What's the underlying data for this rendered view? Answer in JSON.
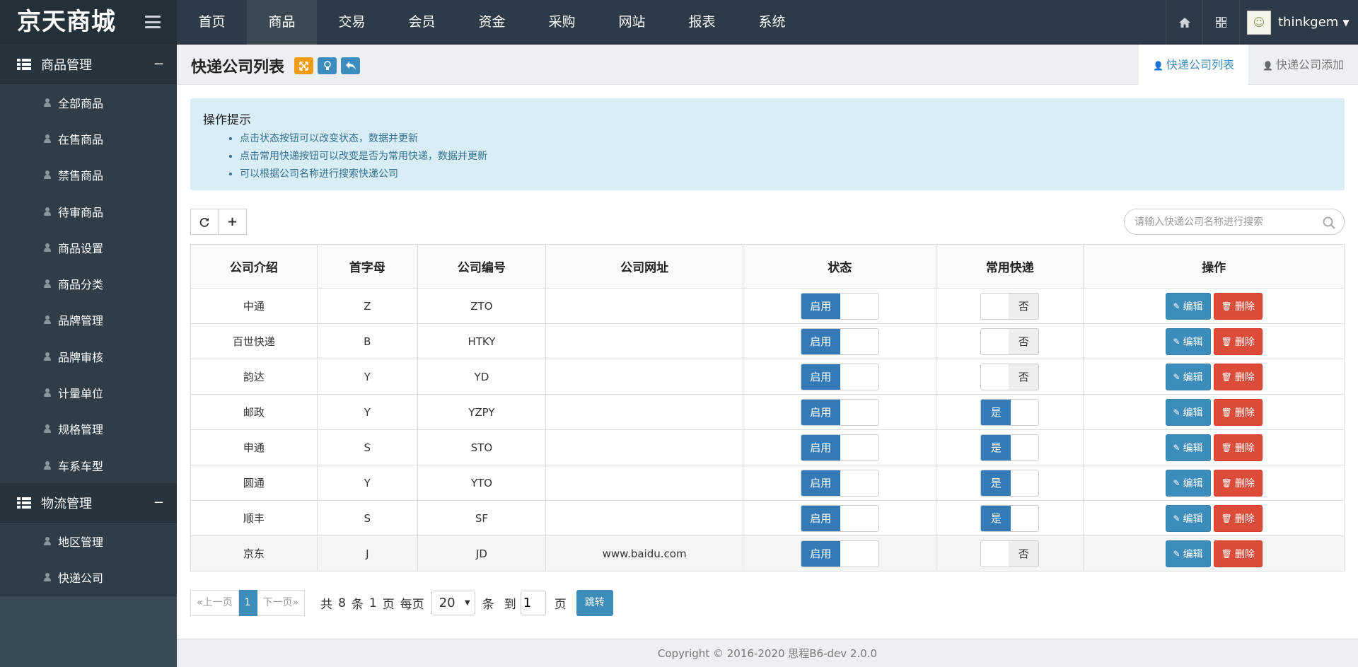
{
  "brand": "京天商城",
  "top_nav": [
    "首页",
    "商品",
    "交易",
    "会员",
    "资金",
    "采购",
    "网站",
    "报表",
    "系统"
  ],
  "top_nav_active_index": 1,
  "user": {
    "name": "thinkgem"
  },
  "sidebar": {
    "groups": [
      {
        "title": "商品管理",
        "toggle": "−",
        "items": [
          "全部商品",
          "在售商品",
          "禁售商品",
          "待审商品",
          "商品设置",
          "商品分类",
          "品牌管理",
          "品牌审核",
          "计量单位",
          "规格管理",
          "车系车型"
        ]
      },
      {
        "title": "物流管理",
        "toggle": "−",
        "items": [
          "地区管理",
          "快递公司"
        ]
      }
    ]
  },
  "page": {
    "title": "快递公司列表",
    "tabs": [
      "快递公司列表",
      "快递公司添加"
    ],
    "active_tab_index": 0
  },
  "tips": {
    "title": "操作提示",
    "items": [
      "点击状态按钮可以改变状态，数据并更新",
      "点击常用快递按钮可以改变是否为常用快递，数据并更新",
      "可以根据公司名称进行搜索快递公司"
    ]
  },
  "search": {
    "placeholder": "请输入快递公司名称进行搜索",
    "value": ""
  },
  "table": {
    "columns": [
      "公司介绍",
      "首字母",
      "公司编号",
      "公司网址",
      "状态",
      "常用快递",
      "操作"
    ],
    "status_label": "启用",
    "common_yes": "是",
    "common_no": "否",
    "edit_label": "编辑",
    "delete_label": "删除",
    "rows": [
      {
        "name": "中通",
        "initial": "Z",
        "code": "ZTO",
        "url": "",
        "common": false
      },
      {
        "name": "百世快递",
        "initial": "B",
        "code": "HTKY",
        "url": "",
        "common": false
      },
      {
        "name": "韵达",
        "initial": "Y",
        "code": "YD",
        "url": "",
        "common": false
      },
      {
        "name": "邮政",
        "initial": "Y",
        "code": "YZPY",
        "url": "",
        "common": true
      },
      {
        "name": "申通",
        "initial": "S",
        "code": "STO",
        "url": "",
        "common": true
      },
      {
        "name": "圆通",
        "initial": "Y",
        "code": "YTO",
        "url": "",
        "common": true
      },
      {
        "name": "顺丰",
        "initial": "S",
        "code": "SF",
        "url": "",
        "common": true
      },
      {
        "name": "京东",
        "initial": "J",
        "code": "JD",
        "url": "www.baidu.com",
        "common": false
      }
    ]
  },
  "pagination": {
    "prev": "«上一页",
    "current": "1",
    "next": "下一页»",
    "total_prefix": "共",
    "total": "8",
    "total_unit": "条",
    "pages": "1",
    "pages_unit": "页",
    "per_page_label": "每页",
    "per_page": "20",
    "per_page_unit": "条",
    "goto_label": "到",
    "goto_value": "1",
    "goto_unit": "页",
    "goto_button": "跳转"
  },
  "footer": "Copyright © 2016-2020  思程B6-dev  2.0.0",
  "colors": {
    "primary": "#3c8dbc",
    "danger": "#dd4b39",
    "switch_on": "#337ab7",
    "tips_bg": "#d9edf7",
    "warning": "#f39c12"
  }
}
